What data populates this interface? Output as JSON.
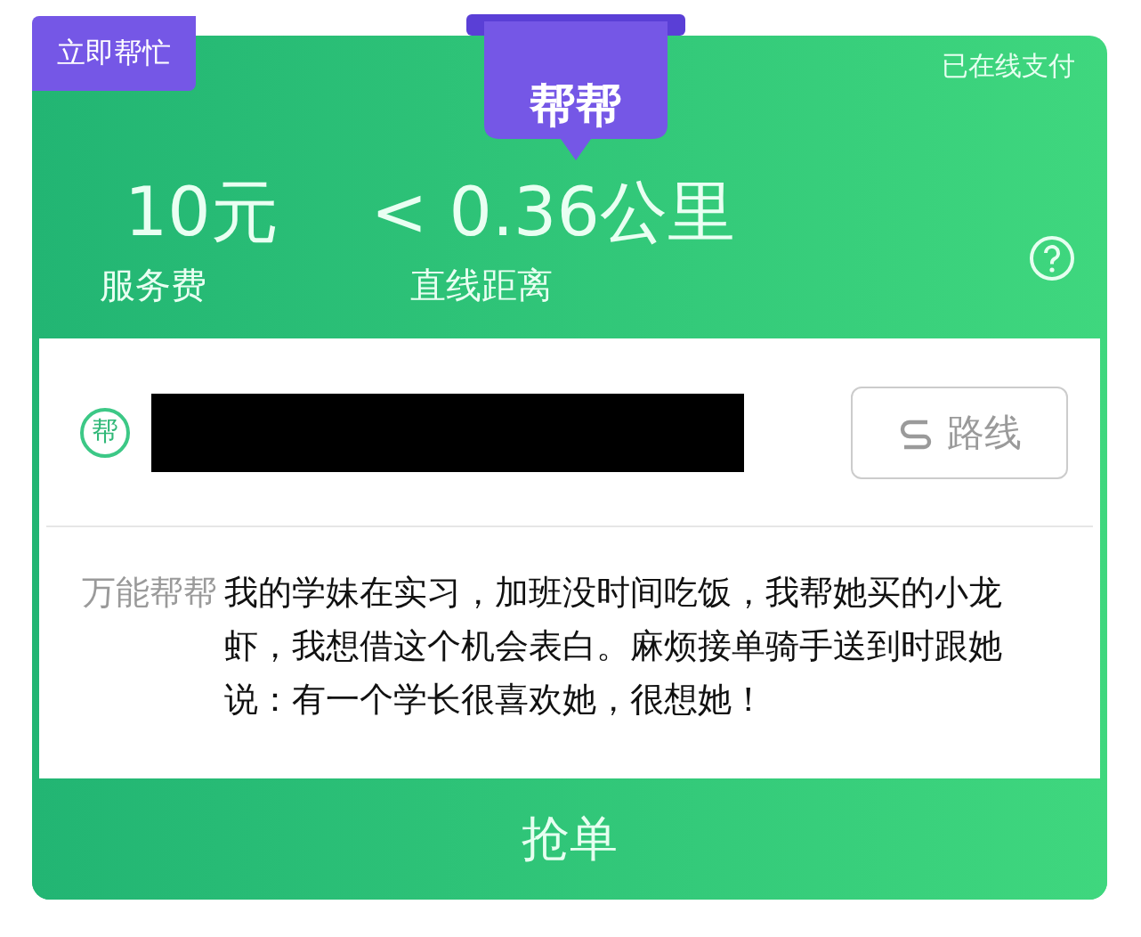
{
  "tag": "立即帮忙",
  "ribbon": "帮帮",
  "payment_status": "已在线支付",
  "stats": [
    {
      "value": "10元",
      "label": "服务费"
    },
    {
      "value": "< 0.36公里",
      "label": "直线距离"
    }
  ],
  "address": {
    "badge": "帮",
    "redacted": true,
    "route_button": "路线"
  },
  "note": {
    "label": "万能帮帮",
    "text": "我的学妹在实习，加班没时间吃饭，我帮她买的小龙虾，我想借这个机会表白。麻烦接单骑手送到时跟她说：有一个学长很喜欢她，很想她！"
  },
  "action_button": "抢单"
}
